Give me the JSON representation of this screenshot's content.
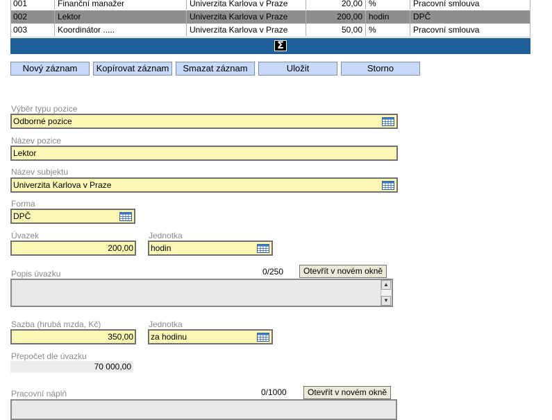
{
  "table": {
    "rows": [
      {
        "code": "001",
        "name": "Finanční manažer",
        "subject": "Univerzita Karlova v Praze",
        "value": "20,00",
        "unit": "%",
        "form": "Pracovní smlouva"
      },
      {
        "code": "002",
        "name": "Lektor",
        "subject": "Univerzita Karlova v Praze",
        "value": "200,00",
        "unit": "hodin",
        "form": "DPČ"
      },
      {
        "code": "003",
        "name": "Koordinátor .....",
        "subject": "Univerzita Karlova v Praze",
        "value": "50,00",
        "unit": "%",
        "form": "Pracovní smlouva"
      }
    ],
    "sum_symbol": "Σ"
  },
  "toolbar": {
    "new": "Nový záznam",
    "copy": "Kopírovat záznam",
    "delete": "Smazat záznam",
    "save": "Uložit",
    "cancel": "Storno"
  },
  "form": {
    "position_type": {
      "label": "Výběr typu pozice",
      "value": "Odborné pozice"
    },
    "position_name": {
      "label": "Název pozice",
      "value": "Lektor"
    },
    "subject_name": {
      "label": "Název subjektu",
      "value": "Univerzita Karlova v Praze"
    },
    "form_type": {
      "label": "Forma",
      "value": "DPČ"
    },
    "workload": {
      "label": "Úvazek",
      "value": "200,00"
    },
    "workload_unit": {
      "label": "Jednotka",
      "value": "hodin"
    },
    "workload_desc": {
      "label": "Popis úvazku",
      "counter": "0/250",
      "open_btn": "Otevřít v novém okně"
    },
    "rate": {
      "label": "Sazba (hrubá mzda, Kč)",
      "value": "350,00"
    },
    "rate_unit": {
      "label": "Jednotka",
      "value": "za hodinu"
    },
    "recalc": {
      "label": "Přepočet dle úvazku",
      "value": "70 000,00"
    },
    "job_content": {
      "label": "Pracovní náplň",
      "counter": "0/1000",
      "open_btn": "Otevřít v novém okně"
    }
  },
  "colors": {
    "accent_bar": "#1f5f9a",
    "field_bg": "#fcf7b5",
    "button_bg": "#c7d8f8"
  }
}
